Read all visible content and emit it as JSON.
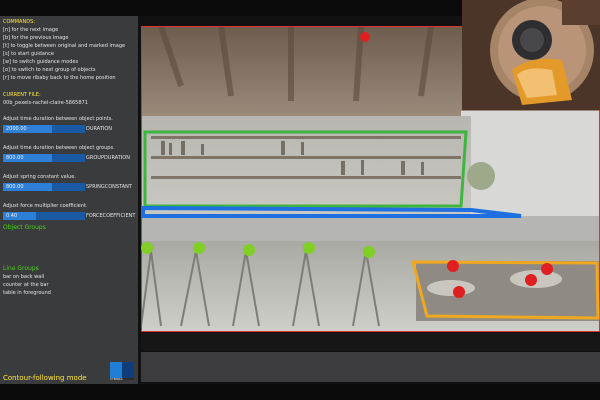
{
  "commands": {
    "heading": "COMMANDS:",
    "lines": [
      "[n] for the next image",
      "[b] for the previous image",
      "[t] to toggle between original and marked image",
      "[s] to start guidance",
      "[w] to switch guidance modes",
      "[o] to switch to next group of objects",
      "[r] to move ribaby back to the home position"
    ]
  },
  "current_file": {
    "heading": "CURRENT FILE:",
    "value": "00b_pexels-rachel-claire-5865871"
  },
  "sliders": [
    {
      "prompt": "Adjust time duration between object points.",
      "value": "2000.00",
      "label": "DURATION",
      "level": 0.6
    },
    {
      "prompt": "Adjust time duration between object groups.",
      "value": "800.00",
      "label": "GROUPDURATION",
      "level": 0.6
    },
    {
      "prompt": "Adjust spring constant value.",
      "value": "800.00",
      "label": "SPRINGCONSTANT",
      "level": 0.6
    },
    {
      "prompt": "Adjust force multiplier coefficient.",
      "value": "0.40",
      "label": "FORCECOEFFICIENT",
      "level": 0.4
    }
  ],
  "object_groups": {
    "heading": "Object Groups"
  },
  "line_groups": {
    "heading": "Line Groups",
    "items": [
      "bar on back wall",
      "counter at the bar",
      "table in foreground"
    ]
  },
  "mode": {
    "label": "Contour-following mode"
  },
  "logo": {
    "text": "CYBORG"
  },
  "colors": {
    "sidebar_bg": "#3a3b3d",
    "accent_yellow": "#ffe93a",
    "accent_green": "#4ad21b",
    "slider_blue": "#2d7fd8",
    "outline_red": "#e03030",
    "contour_green": "#3fb541",
    "contour_blue": "#1e6fe0",
    "contour_orange": "#f0a81e"
  }
}
